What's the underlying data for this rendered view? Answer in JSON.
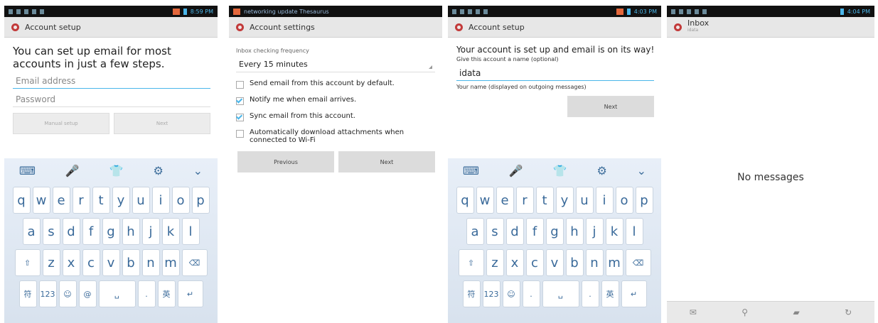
{
  "phone1": {
    "status_time": "8:59 PM",
    "title": "Account setup",
    "heading": "You can set up email for most accounts in just a few steps.",
    "email_placeholder": "Email address",
    "password_placeholder": "Password",
    "manual_setup": "Manual setup",
    "next": "Next"
  },
  "phone2": {
    "status_title": "networking update Thesaurus",
    "title": "Account settings",
    "freq_label": "Inbox checking frequency",
    "freq_value": "Every 15 minutes",
    "options": [
      {
        "label": "Send email from this account by default.",
        "checked": false
      },
      {
        "label": "Notify me when email arrives.",
        "checked": true
      },
      {
        "label": "Sync email from this account.",
        "checked": true
      },
      {
        "label": "Automatically download attachments when connected to Wi-Fi",
        "checked": false
      }
    ],
    "previous": "Previous",
    "next": "Next"
  },
  "phone3": {
    "status_time": "4:03 PM",
    "title": "Account setup",
    "heading": "Your account is set up and email is on its way!",
    "name_label": "Give this account a name (optional)",
    "name_value": "idata",
    "your_name_label": "Your name (displayed on outgoing messages)",
    "next": "Next"
  },
  "phone4": {
    "status_time": "4:04 PM",
    "title": "Inbox",
    "subtitle": "idata",
    "empty_message": "No messages"
  },
  "keyboard": {
    "row1": [
      "q",
      "w",
      "e",
      "r",
      "t",
      "y",
      "u",
      "i",
      "o",
      "p"
    ],
    "row2": [
      "a",
      "s",
      "d",
      "f",
      "g",
      "h",
      "j",
      "k",
      "l"
    ],
    "row3": [
      "z",
      "x",
      "c",
      "v",
      "b",
      "n",
      "m"
    ],
    "bottom_left": "符",
    "num_key": "123",
    "at_key": "@",
    "dot_key": ".",
    "lang_key": "英"
  }
}
